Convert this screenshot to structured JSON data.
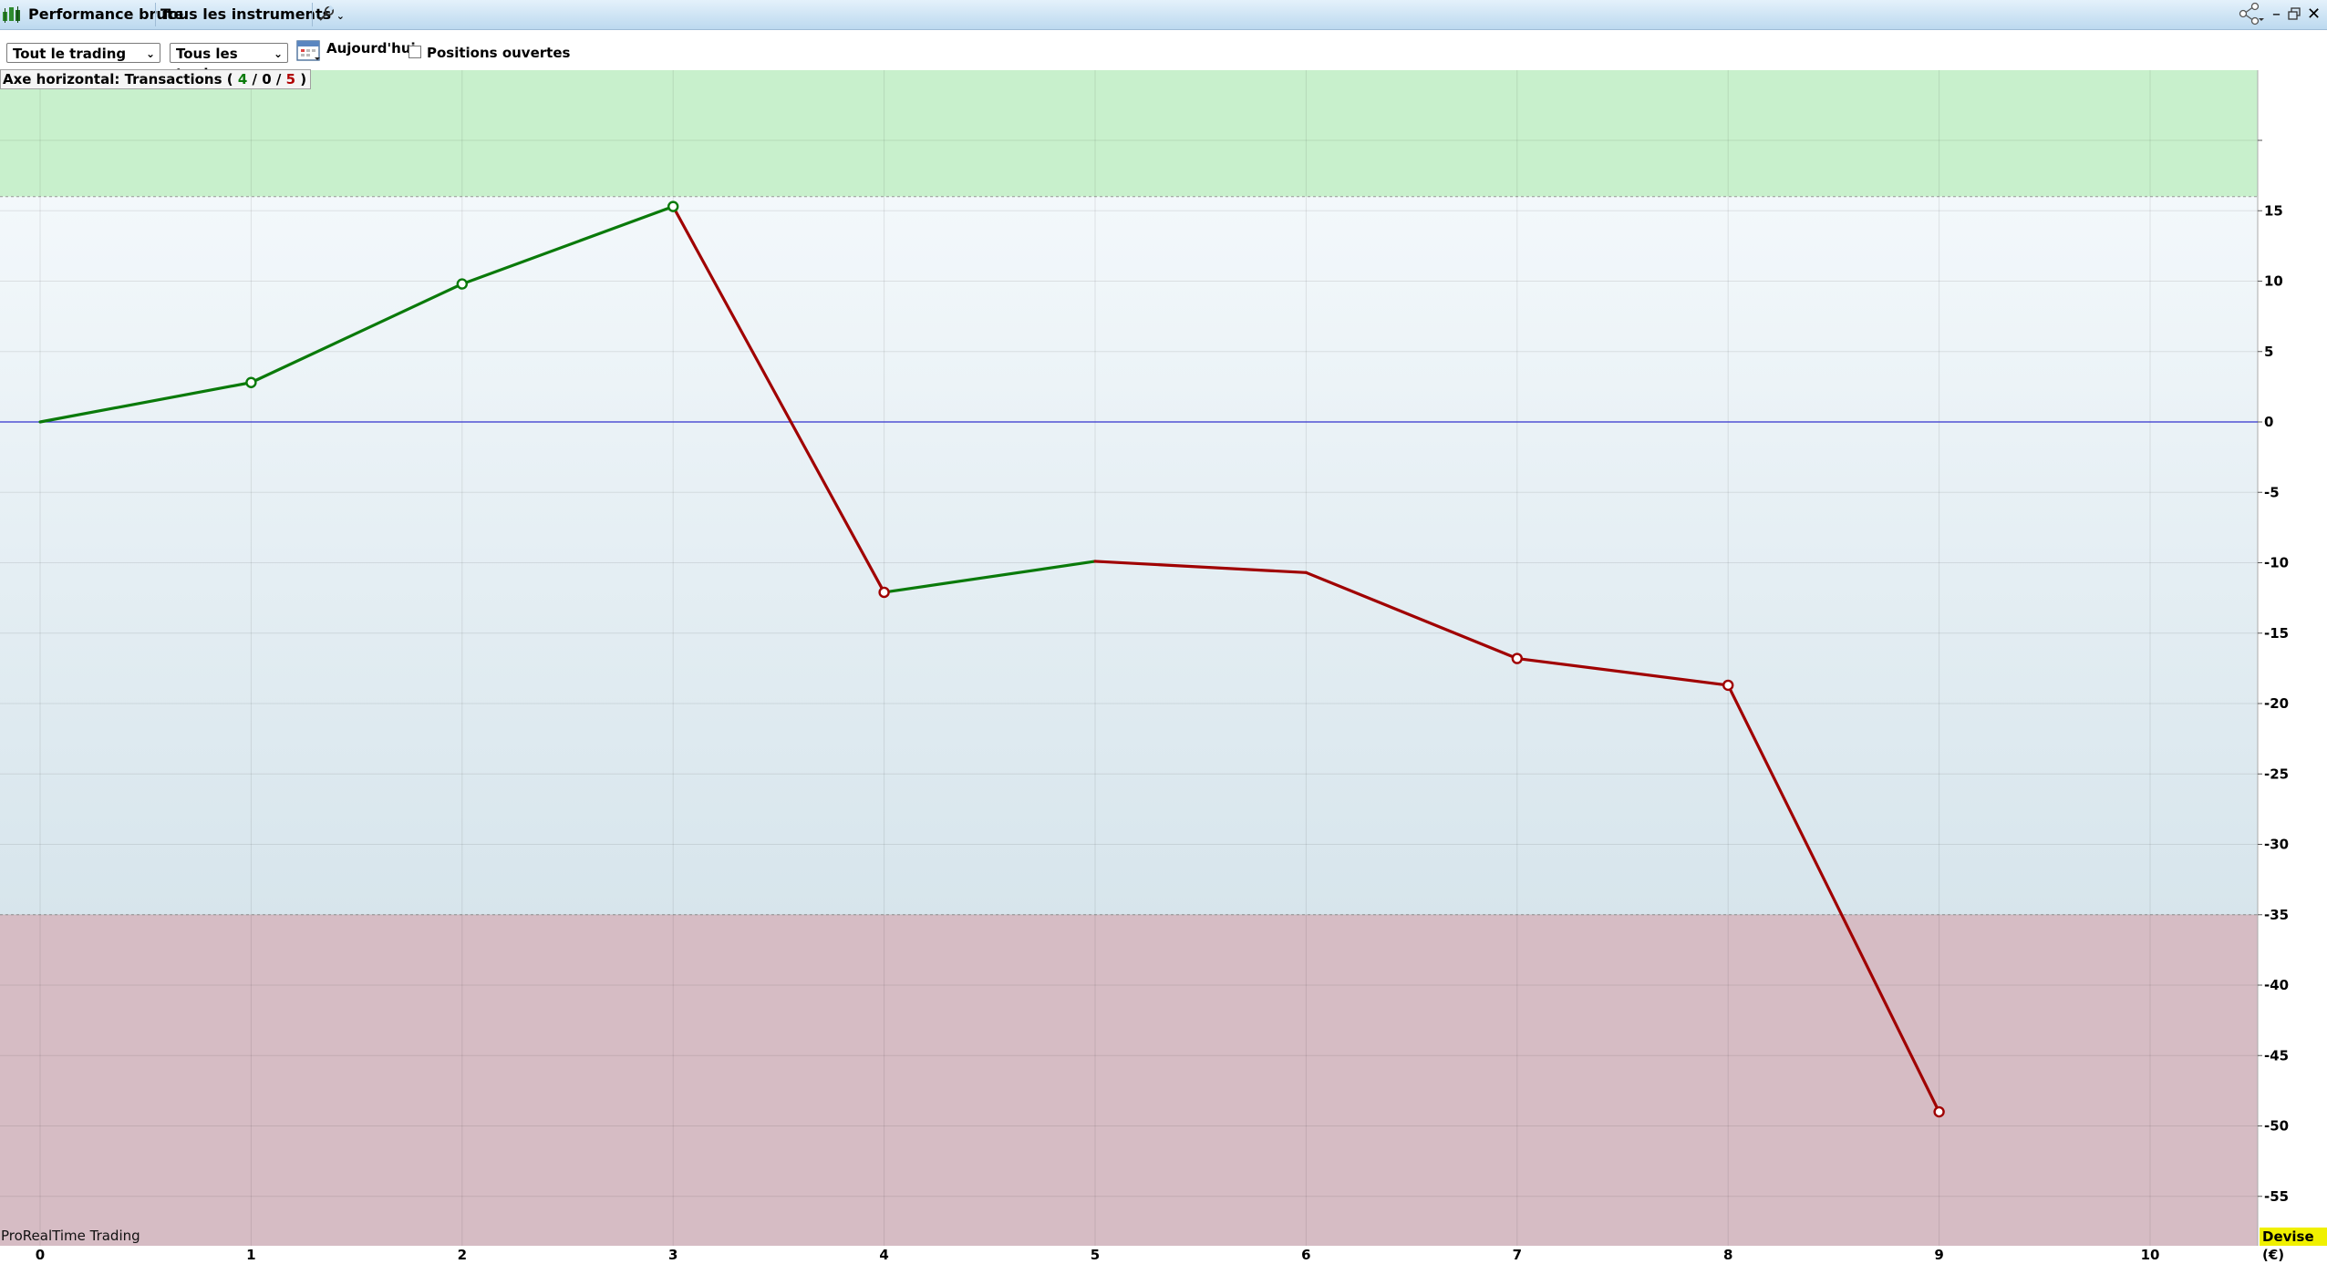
{
  "titlebar": {
    "title": "Performance brute",
    "instruments_label": "Tous les instruments",
    "icons": [
      "chart-app-icon",
      "chevron-down-icon",
      "wrench-icon",
      "share-icon",
      "minimize-icon",
      "restore-icon",
      "close-icon"
    ]
  },
  "toolbar": {
    "period_select": "Tout le trading",
    "trades_select": "Tous les trades",
    "date_label": "Aujourd'hui",
    "open_positions_label": "Positions ouvertes",
    "open_positions_checked": false
  },
  "axis_info": {
    "prefix": "Axe horizontal: Transactions ( ",
    "wins": "4",
    "slash1": " / ",
    "neutral": "0",
    "slash2": " / ",
    "losses": "5",
    "suffix": " )"
  },
  "footer": {
    "brand": "ProRealTime Trading",
    "currency": "Devise (€)"
  },
  "colors": {
    "gain": "#0a7a0a",
    "loss": "#a00000",
    "zero_line": "#3333cc",
    "zone_top": "#c8f0cc",
    "zone_bottom": "#d6bcc4"
  },
  "chart_data": {
    "type": "line",
    "x": [
      0,
      1,
      2,
      3,
      4,
      5,
      6,
      7,
      8,
      9
    ],
    "values": [
      0,
      2.8,
      9.8,
      15.3,
      -12.1,
      -9.9,
      -10.7,
      -16.8,
      -18.7,
      -49.0
    ],
    "markers": [
      false,
      true,
      true,
      true,
      true,
      false,
      false,
      true,
      true,
      true
    ],
    "xlim": [
      0,
      10.5
    ],
    "ylim": [
      -58.5,
      25
    ],
    "xticks": [
      "0",
      "1",
      "2",
      "3",
      "4",
      "5",
      "6",
      "7",
      "8",
      "9",
      "10"
    ],
    "yticks": [
      15,
      10,
      5,
      0,
      -5,
      -10,
      -15,
      -20,
      -25,
      -30,
      -35,
      -40,
      -45,
      -50,
      -55
    ],
    "ytick_labels": [
      "15",
      "10",
      "5",
      "0",
      "-5",
      "-10",
      "-15",
      "-20",
      "-25",
      "-30",
      "-35",
      "-40",
      "-45",
      "-50",
      "-55"
    ],
    "upper_zone_from": 16,
    "lower_zone_to": -35,
    "grid": true
  }
}
